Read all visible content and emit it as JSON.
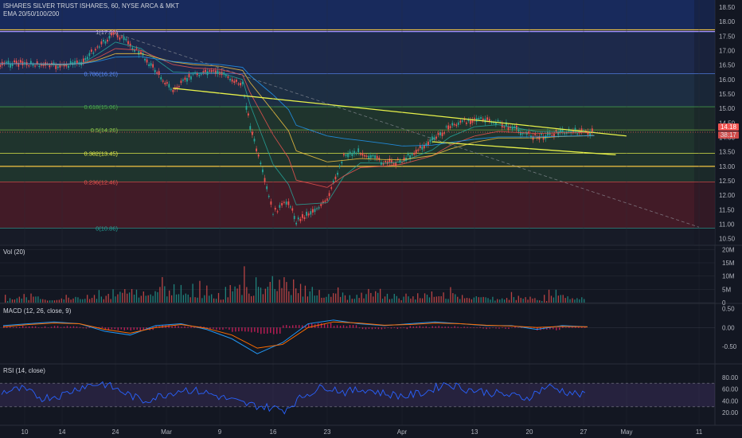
{
  "header": {
    "title": "ISHARES SILVER TRUST ISHARES, 60, NYSE ARCA & MKT",
    "ema_label": "EMA 20/50/100/200"
  },
  "panes": {
    "vol_label": "Vol (20)",
    "macd_label": "MACD (12, 26, close, 9)",
    "rsi_label": "RSI (14, close)"
  },
  "price_tags": {
    "last": "14.18",
    "countdown": "38:17"
  },
  "colors": {
    "background": "#131722",
    "fib_red": "#b22833",
    "fib_green": "#4caf50",
    "fib_blue": "#2962ff",
    "trendline": "#e8f24a",
    "candle_up": "#26a69a",
    "candle_down": "#ef5350",
    "rsi_line": "#2962ff",
    "rsi_band": "#7e57c2",
    "macd_line": "#2196f3",
    "signal_line": "#ff6d00"
  },
  "chart_data": [
    {
      "type": "candlestick",
      "xlabel": "",
      "ylabel": "",
      "x_ticks": [
        "10",
        "14",
        "24",
        "Mar",
        "9",
        "16",
        "23",
        "Apr",
        "13",
        "20",
        "27",
        "May",
        "11"
      ],
      "y_ticks": [
        "10.50",
        "11.00",
        "11.50",
        "12.00",
        "12.50",
        "13.00",
        "13.50",
        "14.00",
        "14.50",
        "15.00",
        "15.50",
        "16.00",
        "16.50",
        "17.00",
        "17.50",
        "18.00",
        "18.50"
      ],
      "ylim": [
        10.3,
        18.75
      ],
      "fib_levels": [
        {
          "label": "1(17.65)",
          "ratio": 1,
          "value": 17.65
        },
        {
          "label": "0.786(16.20)",
          "ratio": 0.786,
          "value": 16.2
        },
        {
          "label": "0.618(15.06)",
          "ratio": 0.618,
          "value": 15.06
        },
        {
          "label": "0.5(14.26)",
          "ratio": 0.5,
          "value": 14.26
        },
        {
          "label": "0.382(13.45)",
          "ratio": 0.382,
          "value": 13.45
        },
        {
          "label": "0.236(12.46)",
          "ratio": 0.236,
          "value": 12.46
        },
        {
          "label": "0(10.86)",
          "ratio": 0,
          "value": 10.86
        }
      ],
      "horizontal_lines": [
        17.72,
        13.0
      ],
      "last_price": 14.18,
      "close_path": [
        [
          "Feb 3",
          16.55
        ],
        [
          "Feb 10",
          16.55
        ],
        [
          "Feb 14",
          16.45
        ],
        [
          "Feb 18",
          16.65
        ],
        [
          "Feb 21",
          17.2
        ],
        [
          "Feb 24",
          17.6
        ],
        [
          "Feb 27",
          16.9
        ],
        [
          "Mar 2",
          15.6
        ],
        [
          "Mar 5",
          16.2
        ],
        [
          "Mar 9",
          16.25
        ],
        [
          "Mar 12",
          15.8
        ],
        [
          "Mar 13",
          14.4
        ],
        [
          "Mar 16",
          11.4
        ],
        [
          "Mar 18",
          11.8
        ],
        [
          "Mar 19",
          11.1
        ],
        [
          "Mar 23",
          11.8
        ],
        [
          "Mar 25",
          13.4
        ],
        [
          "Mar 27",
          13.5
        ],
        [
          "Mar 30",
          13.1
        ],
        [
          "Apr 1",
          13.2
        ],
        [
          "Apr 6",
          13.9
        ],
        [
          "Apr 9",
          14.4
        ],
        [
          "Apr 13",
          14.65
        ],
        [
          "Apr 16",
          14.5
        ],
        [
          "Apr 21",
          14.0
        ],
        [
          "Apr 24",
          14.2
        ],
        [
          "Apr 28",
          14.18
        ]
      ],
      "trendlines": [
        {
          "from": [
            "Mar 2",
            15.7
          ],
          "to": [
            "May 1",
            14.05
          ]
        },
        {
          "from": [
            "Apr 6",
            13.85
          ],
          "to": [
            "Apr 30",
            13.4
          ]
        },
        {
          "from": [
            "Feb 24",
            17.6
          ],
          "to": [
            "May 11",
            10.9
          ],
          "dashed": true
        }
      ]
    },
    {
      "type": "bar",
      "series": [
        {
          "values": [
            3,
            4,
            2,
            5,
            3,
            6,
            8,
            5,
            12,
            7,
            9,
            6,
            14,
            10,
            17,
            11,
            8,
            6,
            5,
            7,
            6,
            4,
            5,
            6,
            4,
            5,
            3,
            4,
            3,
            5,
            3
          ]
        }
      ],
      "y_ticks": [
        "0",
        "5M",
        "10M",
        "15M",
        "20M"
      ],
      "ylim": [
        0,
        21
      ]
    },
    {
      "type": "line",
      "series": [
        {
          "values": [
            0.05,
            0.1,
            0.15,
            0.1,
            -0.1,
            -0.2,
            0.05,
            0.1,
            -0.05,
            -0.3,
            -0.7,
            -0.4,
            0.1,
            0.2,
            0.1,
            0.05,
            0.1,
            0.15,
            0.1,
            0.05,
            0.05,
            -0.05,
            0.05,
            0.02
          ]
        },
        {
          "values": [
            0.02,
            0.08,
            0.12,
            0.1,
            -0.05,
            -0.15,
            0.0,
            0.08,
            -0.02,
            -0.2,
            -0.55,
            -0.45,
            0.0,
            0.15,
            0.12,
            0.06,
            0.08,
            0.12,
            0.1,
            0.06,
            0.04,
            0.0,
            0.03,
            0.02
          ]
        }
      ],
      "y_ticks": [
        "0.50",
        "0.00",
        "-0.50"
      ],
      "ylim": [
        -0.95,
        0.6
      ]
    },
    {
      "type": "line",
      "series": [
        {
          "values": [
            55,
            60,
            45,
            50,
            65,
            70,
            55,
            40,
            50,
            60,
            55,
            45,
            35,
            30,
            25,
            50,
            65,
            55,
            60,
            52,
            48,
            55,
            70,
            60,
            55,
            50,
            45,
            65,
            55,
            48
          ]
        }
      ],
      "y_ticks": [
        "80.00",
        "60.00",
        "40.00",
        "20.00"
      ],
      "ylim": [
        0,
        100
      ]
    }
  ]
}
